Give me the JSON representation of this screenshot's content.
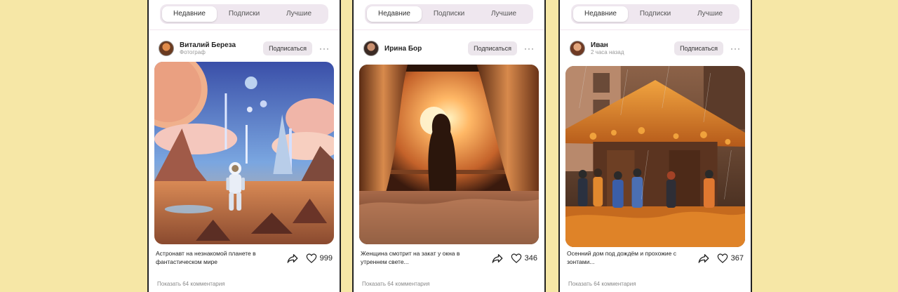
{
  "tabs": [
    "Недавние",
    "Подписки",
    "Лучшие"
  ],
  "subscribe_label": "Подписаться",
  "more_label": "···",
  "colors": {
    "page_background": "#f6e7a6",
    "tab_track": "#efe7ef",
    "button_background": "#ece6ec"
  },
  "posts": [
    {
      "author_name": "Виталий Береза",
      "author_sub": "Фотограф",
      "image_description_icon": "astronaut-alien-planet-image",
      "caption": "Астронавт на незнакомой планете в фантастическом мире",
      "likes": "999",
      "comments": "Показать 64 комментария"
    },
    {
      "author_name": "Ирина Бор",
      "author_sub": "",
      "image_description_icon": "woman-at-sunset-window-image",
      "caption": "Женщина смотрит на закат у окна в утреннем свете...",
      "likes": "346",
      "comments": "Показать 64 комментария"
    },
    {
      "author_name": "Иван",
      "author_sub": "2 часа назад",
      "image_description_icon": "autumn-house-in-rain-image",
      "caption": "Осенний дом под дождём и прохожие с зонтами...",
      "likes": "367",
      "comments": "Показать 64 комментария"
    }
  ]
}
